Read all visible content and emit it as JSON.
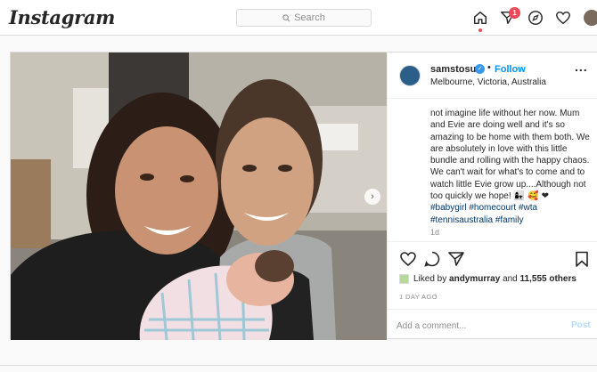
{
  "header": {
    "logo": "Instagram",
    "search_placeholder": "Search",
    "notification_count": "1",
    "icons": [
      "home-icon",
      "direct-message-icon",
      "explore-compass-icon",
      "activity-heart-icon",
      "profile-avatar"
    ]
  },
  "post": {
    "username": "samstosur",
    "follow_label": "Follow",
    "location": "Melbourne, Victoria, Australia",
    "more_label": "...",
    "caption_text": "not imagine life without her now. Mum and Evie are doing well and it's so amazing to be home with them both. We are absolutely in love with this little bundle and rolling with the happy chaos. We can't wait for what's to come and to watch little Evie grow up....Although not too quickly we hope!",
    "caption_emojis": "👩‍👧 🥰 ❤",
    "hashtags_line1": "#babygirl #homecourt #wta",
    "hashtags_line2": "#tennisaustralia #family",
    "age": "1d",
    "likes_prefix": "Liked by",
    "likes_user": "andymurray",
    "likes_and": "and",
    "likes_count": "11,555 others",
    "time_ago": "1 DAY AGO",
    "comment_placeholder": "Add a comment...",
    "post_button": "Post"
  },
  "colors": {
    "accent": "#0095f6",
    "badge": "#ed4956",
    "hashtag": "#00376b",
    "border": "#dbdbdb"
  }
}
